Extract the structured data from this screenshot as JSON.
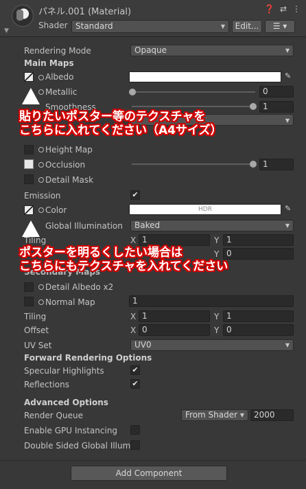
{
  "header": {
    "title": "パネル.001 (Material)",
    "shader_label": "Shader",
    "shader_value": "Standard",
    "edit_label": "Edit...",
    "icons": [
      "help-icon",
      "presets-icon",
      "more-icon"
    ]
  },
  "rendering": {
    "mode_label": "Rendering Mode",
    "mode_value": "Opaque"
  },
  "main_maps": {
    "heading": "Main Maps",
    "albedo": "Albedo",
    "metallic": "Metallic",
    "metallic_value": "0",
    "metallic_level": 0.0,
    "smoothness": "Smoothness",
    "smoothness_value": "1",
    "smoothness_level": 1.0,
    "height_map": "Height Map",
    "occlusion": "Occlusion",
    "occlusion_value": "1",
    "occlusion_level": 1.0,
    "detail_mask": "Detail Mask",
    "emission": "Emission",
    "color": "Color",
    "hdr": "HDR",
    "global_illumination": "Global Illumination",
    "gi_value": "Baked",
    "tiling_label": "Tiling",
    "x_label": "X",
    "y_label": "Y",
    "tiling_x": "1",
    "tiling_y": "1",
    "offset_y": "0"
  },
  "secondary_maps": {
    "heading": "Secondary Maps",
    "detail_albedo": "Detail Albedo x2",
    "normal_map": "Normal Map",
    "normal_value": "1",
    "tiling_label": "Tiling",
    "tiling_x": "1",
    "tiling_y": "1",
    "offset_label": "Offset",
    "offset_x": "0",
    "offset_y": "0",
    "uv_set_label": "UV Set",
    "uv_set_value": "UV0"
  },
  "forward": {
    "heading": "Forward Rendering Options",
    "specular": "Specular Highlights",
    "reflections": "Reflections"
  },
  "advanced": {
    "heading": "Advanced Options",
    "render_queue": "Render Queue",
    "from_shader": "From Shader",
    "queue_value": "2000",
    "gpu_instancing": "Enable GPU Instancing",
    "double_sided": "Double Sided Global Illumin"
  },
  "annotations": {
    "note1_line1": "貼りたいポスター等のテクスチャを",
    "note1_line2": "こちらに入れてください（A4サイズ）",
    "note2_line1": "ポスターを明るくしたい場合は",
    "note2_line2": "こちらにもテクスチャを入れてください"
  },
  "footer": {
    "add_component": "Add Component"
  },
  "colors": {
    "panel": "#383838",
    "annotation_outline": "#d50000",
    "annotation_text": "#ffffff"
  }
}
